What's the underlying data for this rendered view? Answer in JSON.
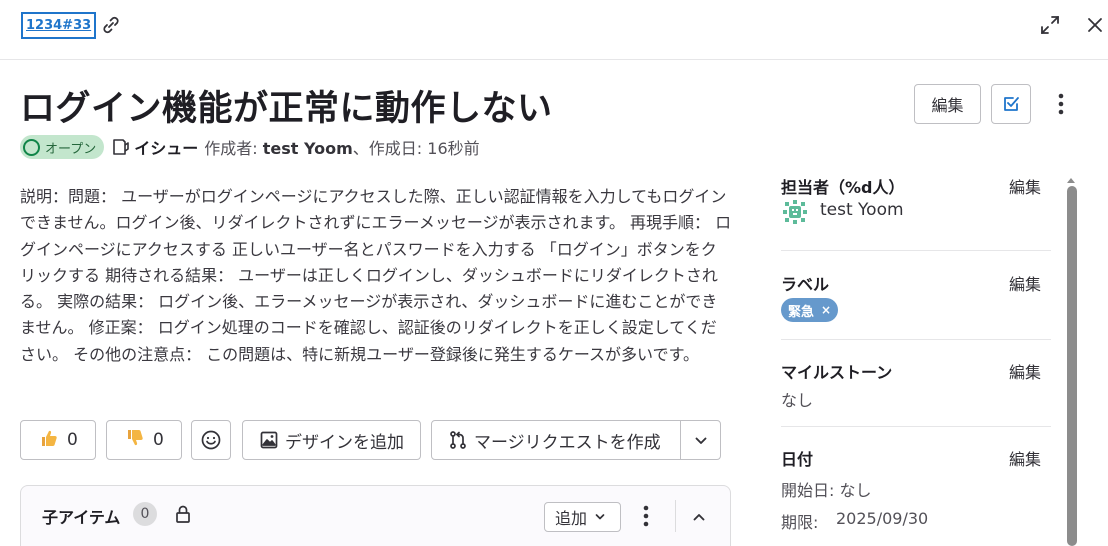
{
  "topbar": {
    "issue_ref": "1234#33",
    "icons": {
      "copy": "link-icon",
      "expand": "expand-icon",
      "close": "close-icon"
    }
  },
  "issue": {
    "title": "ログイン機能が正常に動作しない",
    "status": "オープン",
    "type": "イシュー",
    "author_label": "作成者:",
    "author": "test Yoom",
    "created_sep": "、",
    "created_label": "作成日:",
    "created_value": "16秒前",
    "description": "説明：問題： ユーザーがログインページにアクセスした際、正しい認証情報を入力してもログインできません。ログイン後、リダイレクトされずにエラーメッセージが表示されます。 再現手順： ログインページにアクセスする 正しいユーザー名とパスワードを入力する 「ログイン」ボタンをクリックする 期待される結果： ユーザーは正しくログインし、ダッシュボードにリダイレクトされる。 実際の結果： ログイン後、エラーメッセージが表示され、ダッシュボードに進むことができません。 修正案： ログイン処理のコードを確認し、認証後のリダイレクトを正しく設定してください。 その他の注意点： この問題は、特に新規ユーザー登録後に発生するケースが多いです。"
  },
  "header_actions": {
    "edit": "編集"
  },
  "reactions": {
    "thumbs_up": "0",
    "thumbs_down": "0",
    "add_design": "デザインを追加",
    "create_mr": "マージリクエストを作成"
  },
  "child_items": {
    "title": "子アイテム",
    "count": "0",
    "add": "追加"
  },
  "sidebar": {
    "assignee": {
      "heading": "担当者（%d人）",
      "edit": "編集",
      "name": "test Yoom"
    },
    "labels": {
      "heading": "ラベル",
      "edit": "編集",
      "items": [
        "緊急"
      ],
      "remove": "×",
      "color": "#6699cc"
    },
    "milestone": {
      "heading": "マイルストーン",
      "edit": "編集",
      "value": "なし"
    },
    "dates": {
      "heading": "日付",
      "edit": "編集",
      "start": "開始日: なし",
      "due_label": "期限:",
      "due_value": "2025/09/30"
    }
  },
  "colors": {
    "accent": "#1f75cb",
    "status_bg": "#c3e6cd",
    "status_fg": "#24663b"
  }
}
